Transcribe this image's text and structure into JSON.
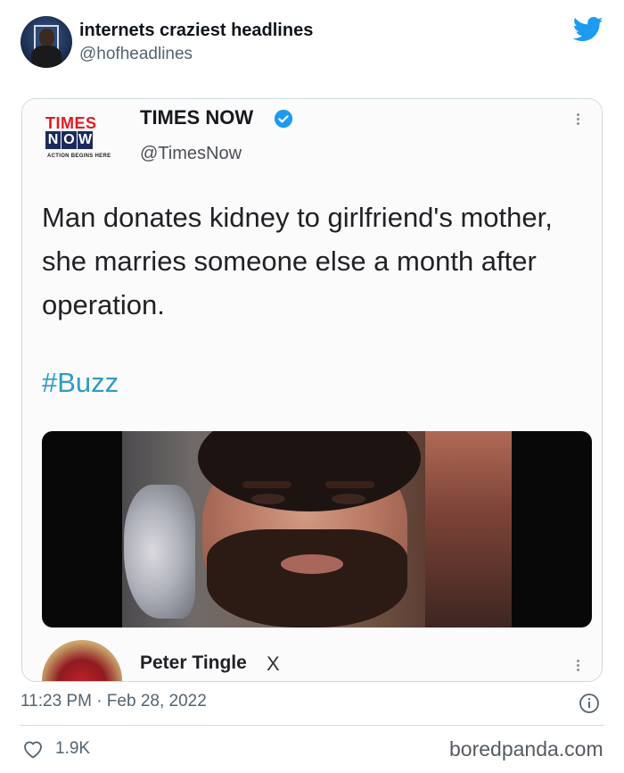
{
  "header": {
    "display_name": "internets craziest headlines",
    "handle": "@hofheadlines",
    "icons": {
      "avatar": "profile-avatar",
      "brand": "twitter-bird-icon"
    },
    "colors": {
      "brand": "#1d9bf0"
    }
  },
  "quoted_tweet": {
    "logo": {
      "line1": "TIMES",
      "line2": [
        "N",
        "O",
        "W"
      ],
      "tagline": "ACTION BEGINS HERE"
    },
    "name": "TIMES NOW",
    "handle": "@TimesNow",
    "text": "Man donates kidney to girlfriend's mother, she marries someone else a month after operation.",
    "hashtag": "#Buzz",
    "media": "photo-of-bearded-man",
    "colors": {
      "hashtag": "#2f9bc2",
      "verified": "#1d9bf0"
    }
  },
  "reply_preview": {
    "name": "Peter Tingle",
    "badge": "X"
  },
  "footer": {
    "timestamp": "11:23 PM · Feb 28, 2022",
    "likes": "1.9K",
    "watermark": "boredpanda.com"
  }
}
